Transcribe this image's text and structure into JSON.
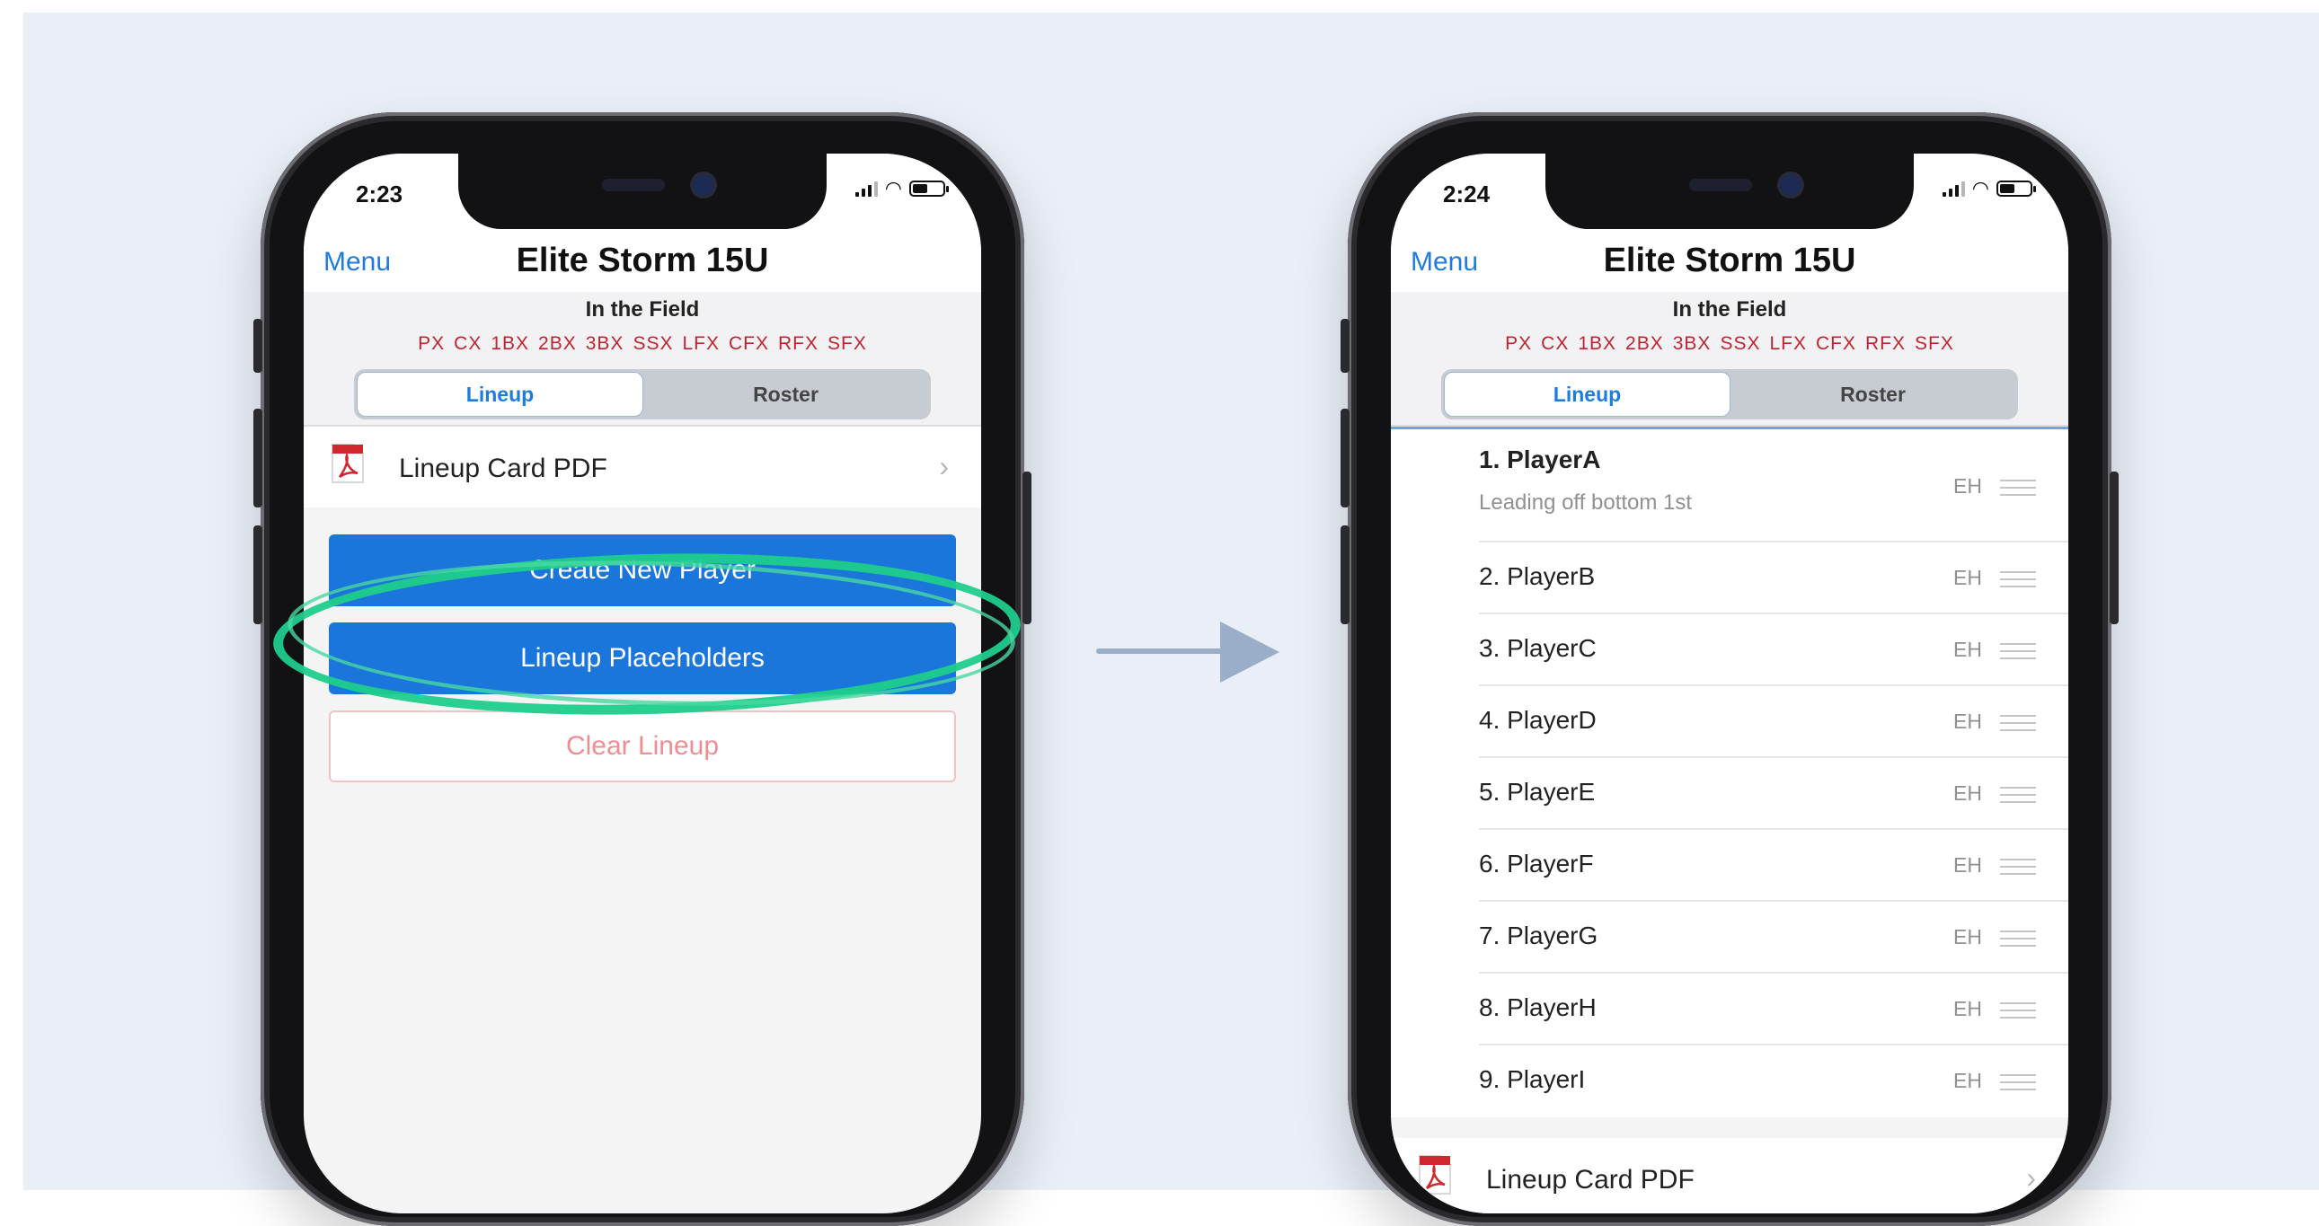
{
  "left_phone": {
    "time": "2:23",
    "nav": {
      "menu": "Menu",
      "title": "Elite Storm 15U"
    },
    "header": {
      "field_title": "In the Field",
      "positions": [
        "PX",
        "CX",
        "1BX",
        "2BX",
        "3BX",
        "SSX",
        "LFX",
        "CFX",
        "RFX",
        "SFX"
      ],
      "tabs": [
        "Lineup",
        "Roster"
      ],
      "active_tab": "Lineup"
    },
    "pdf_row": {
      "label": "Lineup Card PDF",
      "icon": "pdf-icon"
    },
    "buttons": {
      "create": "Create New Player",
      "placeholders": "Lineup Placeholders",
      "clear": "Clear Lineup"
    },
    "highlight_color": "#1fce8c"
  },
  "right_phone": {
    "time": "2:24",
    "nav": {
      "menu": "Menu",
      "title": "Elite Storm 15U"
    },
    "header": {
      "field_title": "In the Field",
      "positions": [
        "PX",
        "CX",
        "1BX",
        "2BX",
        "3BX",
        "SSX",
        "LFX",
        "CFX",
        "RFX",
        "SFX"
      ],
      "tabs": [
        "Lineup",
        "Roster"
      ],
      "active_tab": "Lineup"
    },
    "players": [
      {
        "name": "1. PlayerA",
        "sub": "Leading off bottom 1st",
        "pos": "EH"
      },
      {
        "name": "2. PlayerB",
        "pos": "EH"
      },
      {
        "name": "3. PlayerC",
        "pos": "EH"
      },
      {
        "name": "4. PlayerD",
        "pos": "EH"
      },
      {
        "name": "5. PlayerE",
        "pos": "EH"
      },
      {
        "name": "6. PlayerF",
        "pos": "EH"
      },
      {
        "name": "7. PlayerG",
        "pos": "EH"
      },
      {
        "name": "8. PlayerH",
        "pos": "EH"
      },
      {
        "name": "9. PlayerI",
        "pos": "EH"
      }
    ],
    "pdf_row": {
      "label": "Lineup Card PDF",
      "icon": "pdf-icon"
    }
  },
  "colors": {
    "accent": "#1a76db",
    "link": "#1e7ddc",
    "position_red": "#c0232f",
    "arrow": "#9aaec9",
    "background": "#e9eef7"
  }
}
